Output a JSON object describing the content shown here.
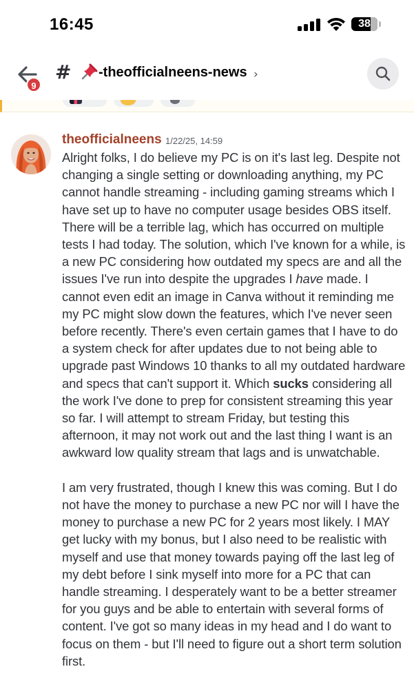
{
  "status_bar": {
    "time": "16:45",
    "battery": "38",
    "battery_level": 0.38,
    "icons": [
      "signal-icon",
      "wifi-icon",
      "battery-icon"
    ]
  },
  "header": {
    "notification_badge": "9",
    "channel_name": "-theofficialneens-news",
    "icons": [
      "back-arrow-icon",
      "hash-icon",
      "pushpin-icon",
      "chevron-right-icon",
      "search-icon"
    ]
  },
  "message": {
    "author": "theofficialneens",
    "timestamp": "1/22/25, 14:59",
    "author_color": "#a3412a",
    "paragraph1": {
      "p1": "Alright folks, I do believe my PC is on it's last leg. Despite not changing a single setting or downloading anything, my PC cannot handle streaming - including gaming streams which I have set up to have no computer usage besides OBS itself. There will be a terrible lag, which has occurred on multiple tests I had today. The solution, which I've known for a while, is a new PC considering how outdated my specs are and all the issues I've run into despite the upgrades I ",
      "em1": "have",
      "p2": " made. I cannot even edit an image in Canva without it reminding me my PC might slow down the features, which I've never seen before recently. There's even certain games that I have to do a system check for after updates due to not being able to upgrade past Windows 10 thanks to all my outdated hardware and specs that can't support it. Which ",
      "strong1": "sucks",
      "p3": " considering all the work I've done to prep for consistent streaming this year so far. I will attempt to stream Friday, but testing this afternoon, it may not work out and the last thing I want is an awkward low quality stream that lags and is unwatchable."
    },
    "paragraph2": "I am very frustrated, though I knew this was coming. But I do not have the money to purchase a new PC nor will I have the money to purchase a new PC for 2 years most likely. I MAY get lucky with my bonus, but I also need to be realistic with myself and use that money towards paying off the last leg of my debt before I sink myself into more for a PC that can handle streaming. I desperately want to be a better streamer for you guys and be able to entertain with several forms of content. I've got so many ideas in my head and I do want to focus on them - but I'll need to figure out a short term solution first."
  }
}
